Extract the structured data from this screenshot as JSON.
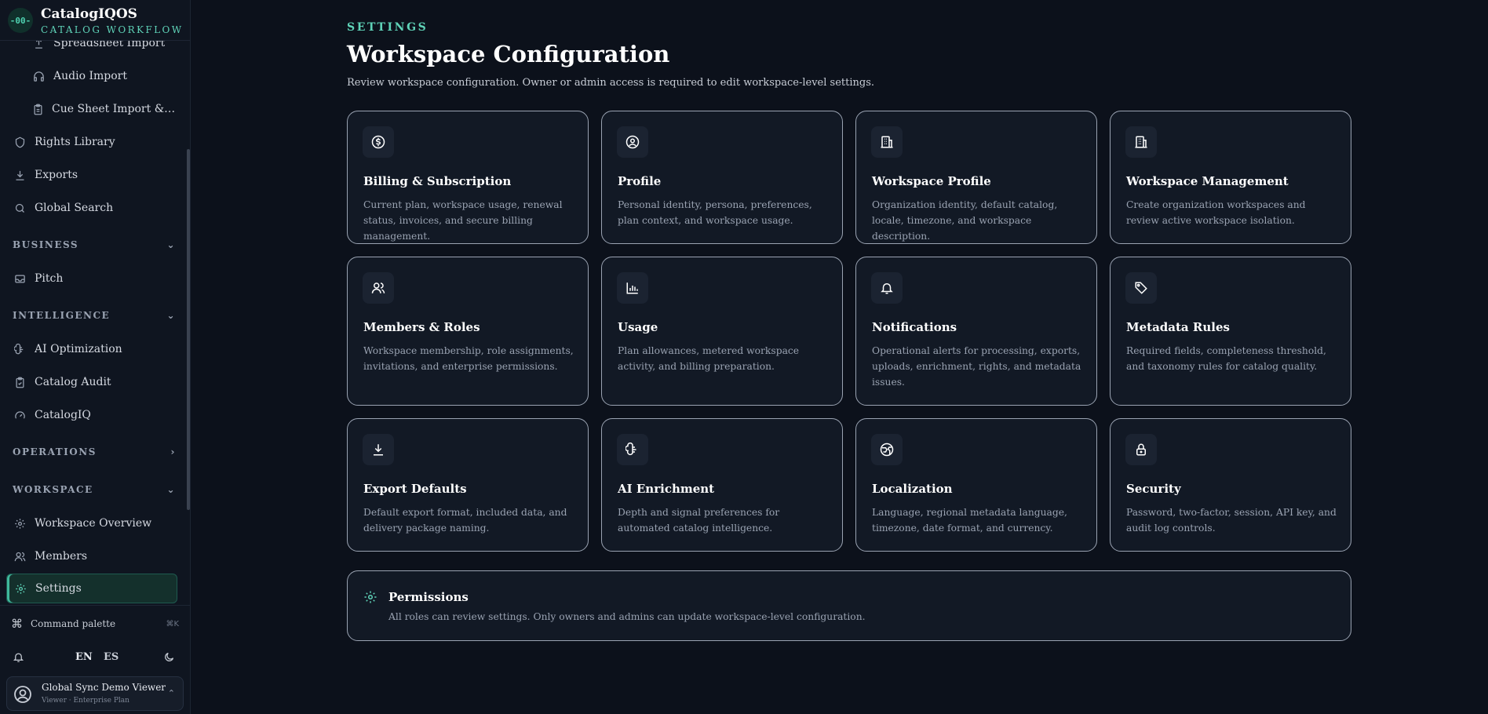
{
  "brand": {
    "logo": "-00-",
    "name": "CatalogIQOS",
    "tagline": "CATALOG WORKFLOW"
  },
  "sidebar": {
    "items": [
      {
        "label": "Spreadsheet Import",
        "icon": "upload-icon"
      },
      {
        "label": "Audio Import",
        "icon": "headphones-icon"
      },
      {
        "label": "Cue Sheet Import & Re...",
        "icon": "clipboard-icon"
      },
      {
        "label": "Rights Library",
        "icon": "shield-icon"
      },
      {
        "label": "Exports",
        "icon": "download-icon"
      },
      {
        "label": "Global Search",
        "icon": "search-icon"
      },
      {
        "label": "Pitch",
        "icon": "inbox-icon"
      },
      {
        "label": "AI Optimization",
        "icon": "brain-icon"
      },
      {
        "label": "Catalog Audit",
        "icon": "clipboard-check-icon"
      },
      {
        "label": "CatalogIQ",
        "icon": "gauge-icon"
      },
      {
        "label": "Workspace Overview",
        "icon": "gear-icon"
      },
      {
        "label": "Members",
        "icon": "users-icon"
      },
      {
        "label": "Settings",
        "icon": "gear-icon"
      }
    ],
    "sections": {
      "business": "BUSINESS",
      "intelligence": "INTELLIGENCE",
      "operations": "OPERATIONS",
      "workspace": "WORKSPACE"
    },
    "command_palette": {
      "label": "Command palette",
      "shortcut": "⌘K"
    },
    "languages": {
      "en": "EN",
      "es": "ES"
    },
    "user": {
      "name": "Global Sync Demo Viewer",
      "role": "Viewer · Enterprise Plan"
    }
  },
  "header": {
    "eyebrow": "SETTINGS",
    "title": "Workspace Configuration",
    "subtitle": "Review workspace configuration. Owner or admin access is required to edit workspace-level settings."
  },
  "cards": [
    {
      "title": "Billing & Subscription",
      "desc": "Current plan, workspace usage, renewal status, invoices, and secure billing management.",
      "icon": "dollar-circle-icon"
    },
    {
      "title": "Profile",
      "desc": "Personal identity, persona, preferences, plan context, and workspace usage.",
      "icon": "user-circle-icon"
    },
    {
      "title": "Workspace Profile",
      "desc": "Organization identity, default catalog, locale, timezone, and workspace description.",
      "icon": "building-icon"
    },
    {
      "title": "Workspace Management",
      "desc": "Create organization workspaces and review active workspace isolation.",
      "icon": "building-icon"
    },
    {
      "title": "Members & Roles",
      "desc": "Workspace membership, role assignments, invitations, and enterprise permissions.",
      "icon": "users-icon"
    },
    {
      "title": "Usage",
      "desc": "Plan allowances, metered workspace activity, and billing preparation.",
      "icon": "bar-chart-icon"
    },
    {
      "title": "Notifications",
      "desc": "Operational alerts for processing, exports, uploads, enrichment, rights, and metadata issues.",
      "icon": "bell-icon"
    },
    {
      "title": "Metadata Rules",
      "desc": "Required fields, completeness threshold, and taxonomy rules for catalog quality.",
      "icon": "tag-icon"
    },
    {
      "title": "Export Defaults",
      "desc": "Default export format, included data, and delivery package naming.",
      "icon": "download-icon"
    },
    {
      "title": "AI Enrichment",
      "desc": "Depth and signal preferences for automated catalog intelligence.",
      "icon": "brain-icon"
    },
    {
      "title": "Localization",
      "desc": "Language, regional metadata language, timezone, date format, and currency.",
      "icon": "globe-icon"
    },
    {
      "title": "Security",
      "desc": "Password, two-factor, session, API key, and audit log controls.",
      "icon": "lock-icon"
    }
  ],
  "permissions": {
    "title": "Permissions",
    "desc": "All roles can review settings. Only owners and admins can update workspace-level configuration."
  },
  "colors": {
    "accent": "#5fd3b8",
    "background": "#0c111b",
    "card": "#121925",
    "border": "#9aa3b2"
  }
}
